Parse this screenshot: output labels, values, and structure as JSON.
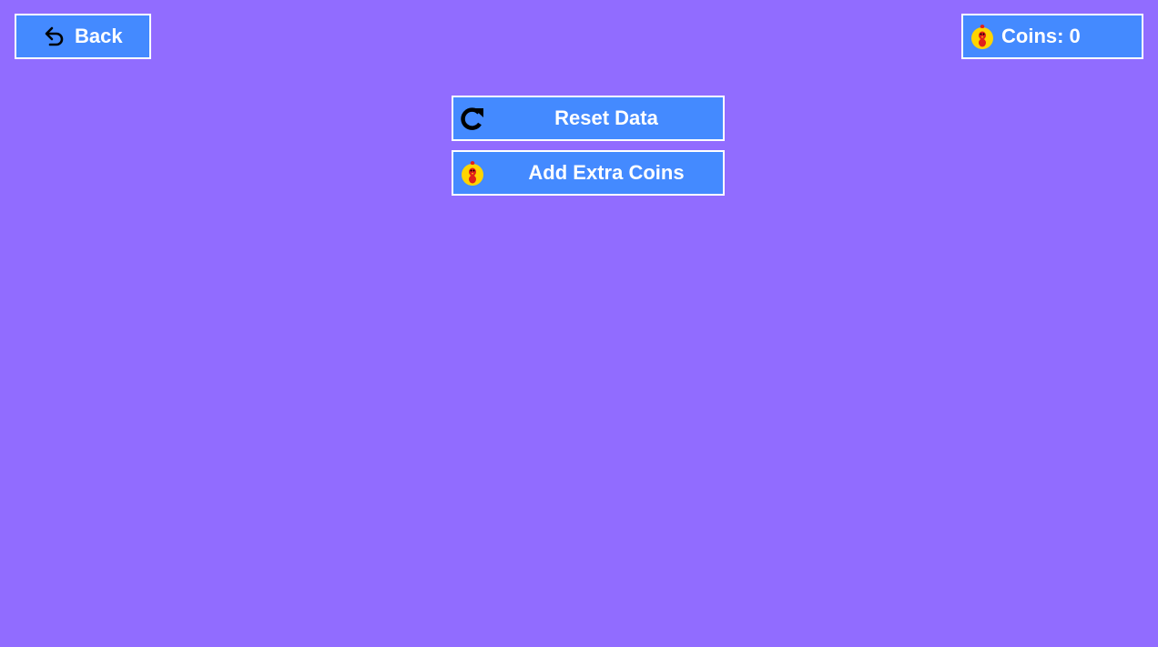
{
  "header": {
    "back_label": "Back",
    "coins_prefix": "Coins:",
    "coins_value": "0",
    "coins_text": "Coins: 0"
  },
  "menu": {
    "reset_label": "Reset Data",
    "add_coins_label": "Add Extra Coins"
  },
  "icons": {
    "back": "undo-arrow-icon",
    "coin": "chicken-coin-icon",
    "reset": "refresh-icon"
  },
  "colors": {
    "background": "#916cff",
    "button_fill": "#448aff",
    "button_border": "#ffffff",
    "text": "#ffffff",
    "coin_yellow": "#ffd400",
    "coin_red": "#e0201b"
  }
}
